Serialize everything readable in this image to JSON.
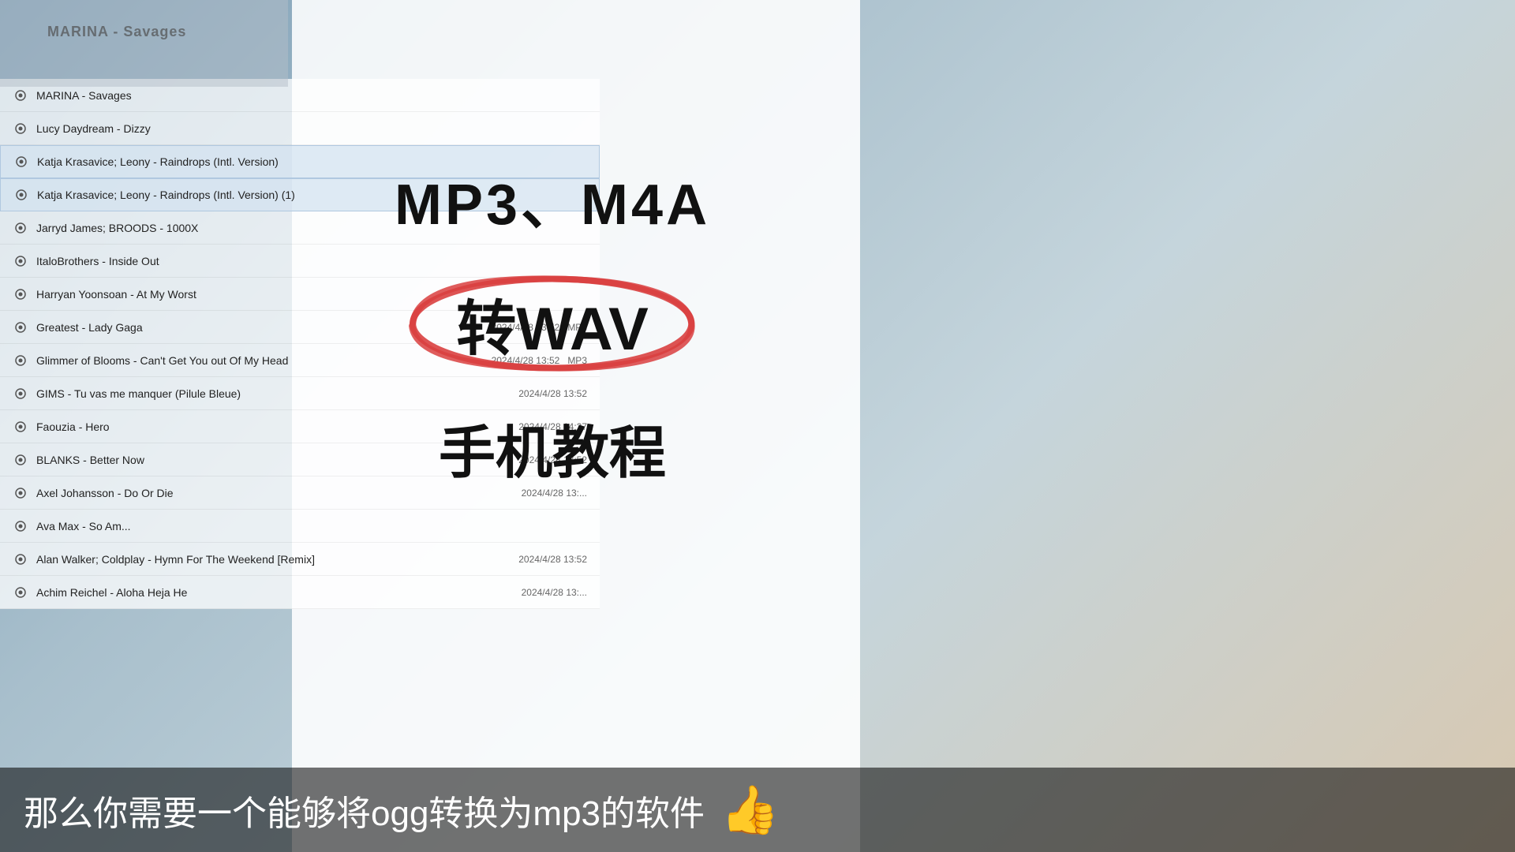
{
  "background": {
    "color": "#b8c8d8"
  },
  "header": {
    "title": "MARINA - Savages"
  },
  "overlay": {
    "title": "MP3、M4A",
    "convert": "转WAV",
    "subtitle": "手机教程"
  },
  "file_list": {
    "items": [
      {
        "name": "MARINA - Savages",
        "date": "",
        "type": "",
        "selected": false
      },
      {
        "name": "Lucy Daydream - Dizzy",
        "date": "",
        "type": "",
        "selected": false
      },
      {
        "name": "Katja Krasavice; Leony - Raindrops (Intl. Version)",
        "date": "",
        "type": "",
        "selected": true
      },
      {
        "name": "Katja Krasavice; Leony - Raindrops (Intl. Version) (1)",
        "date": "",
        "type": "",
        "selected": true
      },
      {
        "name": "Jarryd James; BROODS - 1000X",
        "date": "",
        "type": "",
        "selected": false
      },
      {
        "name": "ItaloBrothers - Inside Out",
        "date": "",
        "type": "",
        "selected": false
      },
      {
        "name": "Harryan Yoonsoan - At My Worst",
        "date": "",
        "type": "",
        "selected": false
      },
      {
        "name": "Greatest - Lady Gaga",
        "date": "2024/4/28 13:52",
        "type": "MP3",
        "selected": false
      },
      {
        "name": "Glimmer of Blooms - Can't Get You out Of My Head",
        "date": "2024/4/28 13:52",
        "type": "MP3",
        "selected": false
      },
      {
        "name": "GIMS - Tu vas me manquer (Pilule Bleue)",
        "date": "2024/4/28 13:52",
        "type": "",
        "selected": false
      },
      {
        "name": "Faouzia - Hero",
        "date": "2024/4/28 14:27",
        "type": "",
        "selected": false
      },
      {
        "name": "BLANKS - Better Now",
        "date": "2024/4/28 13:52",
        "type": "",
        "selected": false
      },
      {
        "name": "Axel Johansson - Do Or Die",
        "date": "2024/4/28 13:...",
        "type": "",
        "selected": false
      },
      {
        "name": "Ava Max - So Am...",
        "date": "",
        "type": "",
        "selected": false
      },
      {
        "name": "Alan Walker; Coldplay - Hymn For The Weekend [Remix]",
        "date": "2024/4/28 13:52",
        "type": "",
        "selected": false
      },
      {
        "name": "Achim Reichel - Aloha Heja He",
        "date": "2024/4/28 13:...",
        "type": "",
        "selected": false
      }
    ]
  },
  "subtitle": {
    "text": "那么你需要一个能够将ogg转换为mp3的软件"
  }
}
